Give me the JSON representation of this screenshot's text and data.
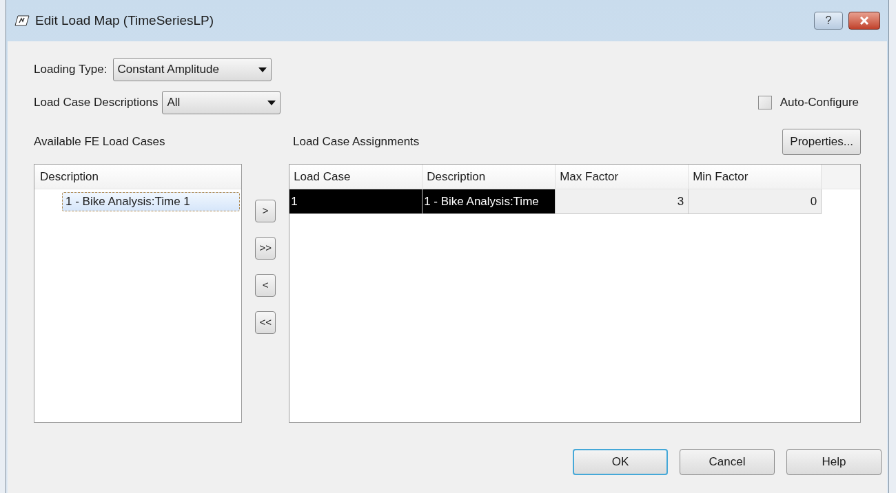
{
  "window": {
    "title": "Edit Load Map (TimeSeriesLP)",
    "help": "?"
  },
  "loading_type": {
    "label": "Loading Type:",
    "value": "Constant Amplitude"
  },
  "load_case_descriptions": {
    "label": "Load Case Descriptions",
    "value": "All"
  },
  "auto_configure": {
    "label": "Auto-Configure",
    "checked": false
  },
  "available": {
    "label": "Available FE Load Cases",
    "column": "Description",
    "items": [
      {
        "label": "1 - Bike Analysis:Time 1",
        "selected": true
      }
    ]
  },
  "move_buttons": [
    ">",
    ">>",
    "<",
    "<<"
  ],
  "assignments": {
    "label": "Load Case Assignments",
    "properties_button": "Properties...",
    "columns": [
      "Load Case",
      "Description",
      "Max Factor",
      "Min Factor"
    ],
    "rows": [
      {
        "cells": [
          "1",
          "1 - Bike Analysis:Time",
          "3",
          "0"
        ],
        "selected": true
      }
    ]
  },
  "buttons": [
    {
      "label": "OK",
      "default": true
    },
    {
      "label": "Cancel",
      "default": false
    },
    {
      "label": "Help",
      "default": false
    }
  ]
}
